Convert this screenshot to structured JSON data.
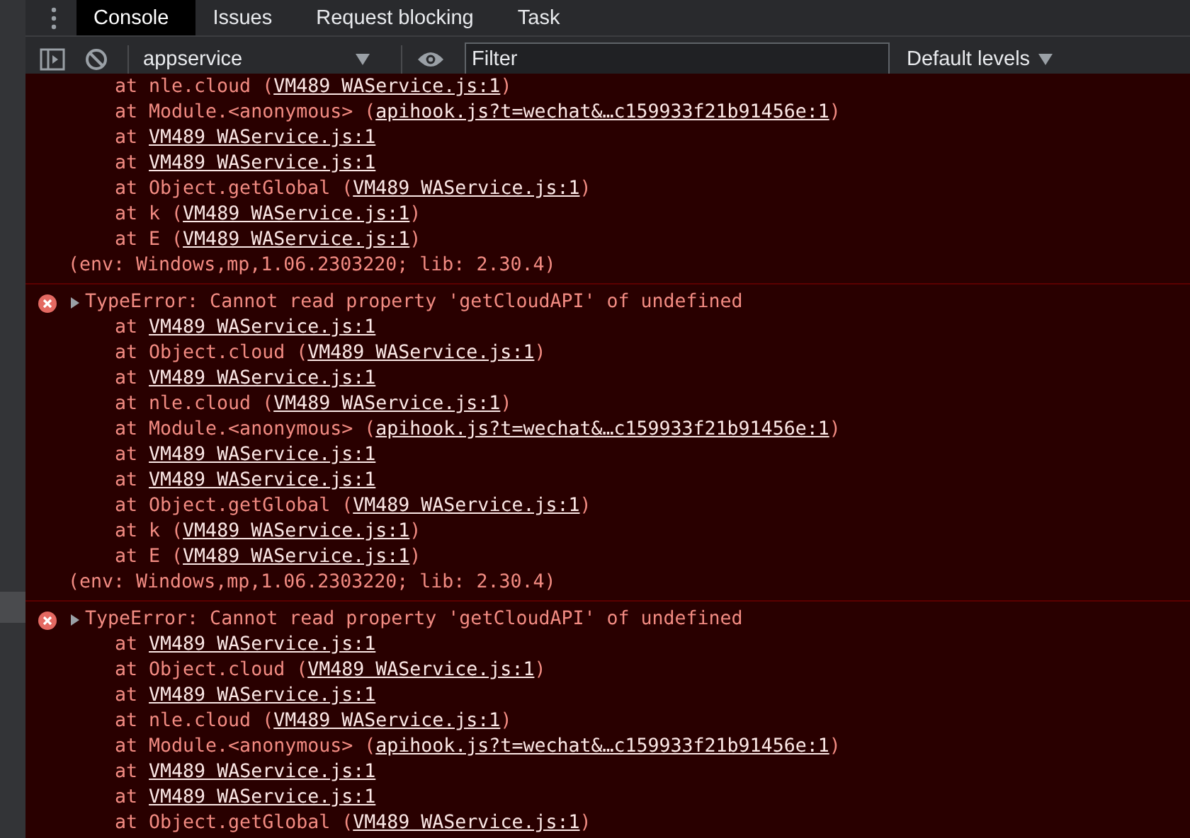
{
  "tabs": [
    {
      "label": "Console",
      "selected": true
    },
    {
      "label": "Issues",
      "selected": false
    },
    {
      "label": "Request blocking",
      "selected": false
    },
    {
      "label": "Task",
      "selected": false
    }
  ],
  "toolbar": {
    "context": "appservice",
    "filter": {
      "placeholder": "Filter"
    },
    "levels": "Default levels"
  },
  "messages": [
    {
      "frames": [
        {
          "text": "at nle.cloud (",
          "link": "VM489 WAService.js:1",
          "after": ")"
        },
        {
          "text": "at Module.<anonymous> (",
          "link": "apihook.js?t=wechat&…c159933f21b91456e:1",
          "after": ")"
        },
        {
          "text": "at ",
          "link": "VM489 WAService.js:1"
        },
        {
          "text": "at ",
          "link": "VM489 WAService.js:1"
        },
        {
          "text": "at Object.getGlobal (",
          "link": "VM489 WAService.js:1",
          "after": ")"
        },
        {
          "text": "at k (",
          "link": "VM489 WAService.js:1",
          "after": ")"
        },
        {
          "text": "at E (",
          "link": "VM489 WAService.js:1",
          "after": ")"
        }
      ],
      "env": "(env: Windows,mp,1.06.2303220; lib: 2.30.4)"
    },
    {
      "header": "TypeError: Cannot read property 'getCloudAPI' of undefined",
      "frames": [
        {
          "text": "at ",
          "link": "VM489 WAService.js:1"
        },
        {
          "text": "at Object.cloud (",
          "link": "VM489 WAService.js:1",
          "after": ")"
        },
        {
          "text": "at ",
          "link": "VM489 WAService.js:1"
        },
        {
          "text": "at nle.cloud (",
          "link": "VM489 WAService.js:1",
          "after": ")"
        },
        {
          "text": "at Module.<anonymous> (",
          "link": "apihook.js?t=wechat&…c159933f21b91456e:1",
          "after": ")"
        },
        {
          "text": "at ",
          "link": "VM489 WAService.js:1"
        },
        {
          "text": "at ",
          "link": "VM489 WAService.js:1"
        },
        {
          "text": "at Object.getGlobal (",
          "link": "VM489 WAService.js:1",
          "after": ")"
        },
        {
          "text": "at k (",
          "link": "VM489 WAService.js:1",
          "after": ")"
        },
        {
          "text": "at E (",
          "link": "VM489 WAService.js:1",
          "after": ")"
        }
      ],
      "env": "(env: Windows,mp,1.06.2303220; lib: 2.30.4)"
    },
    {
      "header": "TypeError: Cannot read property 'getCloudAPI' of undefined",
      "frames": [
        {
          "text": "at ",
          "link": "VM489 WAService.js:1"
        },
        {
          "text": "at Object.cloud (",
          "link": "VM489 WAService.js:1",
          "after": ")"
        },
        {
          "text": "at ",
          "link": "VM489 WAService.js:1"
        },
        {
          "text": "at nle.cloud (",
          "link": "VM489 WAService.js:1",
          "after": ")"
        },
        {
          "text": "at Module.<anonymous> (",
          "link": "apihook.js?t=wechat&…c159933f21b91456e:1",
          "after": ")"
        },
        {
          "text": "at ",
          "link": "VM489 WAService.js:1"
        },
        {
          "text": "at ",
          "link": "VM489 WAService.js:1"
        },
        {
          "text": "at Object.getGlobal (",
          "link": "VM489 WAService.js:1",
          "after": ")"
        }
      ]
    }
  ]
}
